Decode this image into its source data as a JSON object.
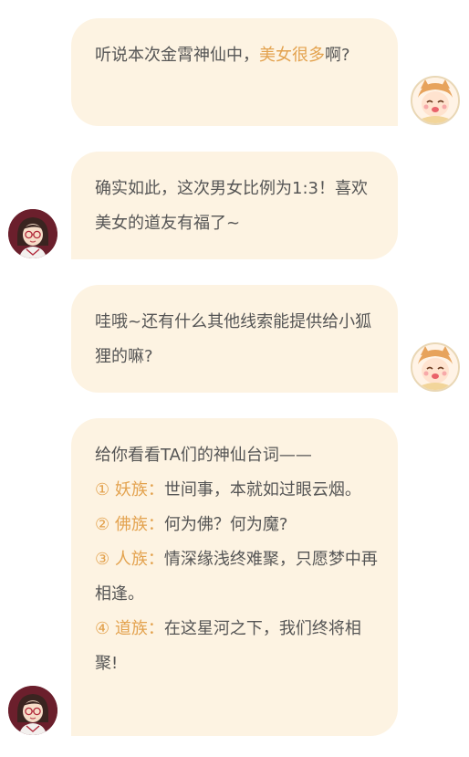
{
  "messages": [
    {
      "side": "right",
      "avatar": "fox-girl-avatar",
      "parts": [
        {
          "text": "听说本次金霄神仙中，",
          "hl": false
        },
        {
          "text": "美女很多",
          "hl": true
        },
        {
          "text": "啊?",
          "hl": false
        }
      ]
    },
    {
      "side": "left",
      "avatar": "woman-with-glasses-avatar",
      "text": "确实如此，这次男女比例为1:3！喜欢美女的道友有福了~"
    },
    {
      "side": "right",
      "avatar": "fox-girl-avatar",
      "text": "哇哦~还有什么其他线索能提供给小狐狸的嘛?"
    },
    {
      "side": "left",
      "avatar": "woman-with-glasses-avatar",
      "intro": "给你看看TA们的神仙台词——",
      "clans": [
        {
          "label": "① 妖族：",
          "quote": "世间事，本就如过眼云烟。"
        },
        {
          "label": "② 佛族：",
          "quote": "何为佛？何为魔?"
        },
        {
          "label": "③ 人族：",
          "quote": "情深缘浅终难聚，只愿梦中再相逢。"
        },
        {
          "label": "④ 道族：",
          "quote": "在这星河之下，我们终将相聚!"
        }
      ]
    }
  ],
  "colors": {
    "bubble": "#fdf3e2",
    "highlight": "#e3a24e",
    "text": "#555555"
  }
}
